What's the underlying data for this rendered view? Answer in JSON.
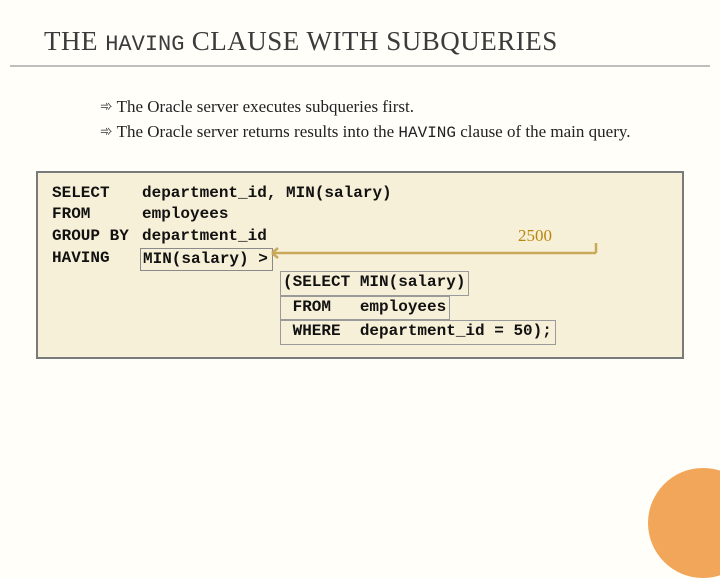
{
  "title": {
    "pre": "THE ",
    "mono": "HAVING",
    "post": " CLAUSE WITH SUBQUERIES"
  },
  "bullets": [
    {
      "pre": "The Oracle server executes subqueries first.",
      "mono": "",
      "post": ""
    },
    {
      "pre": "The Oracle server returns results into the ",
      "mono": "HAVING",
      "post": " clause of the main query."
    }
  ],
  "code": {
    "l1kw": "SELECT",
    "l1rest": "department_id, MIN(salary)",
    "l2kw": "FROM",
    "l2rest": "employees",
    "l3kw": "GROUP BY",
    "l3rest": "department_id",
    "l4kw": "HAVING",
    "l4expr": "MIN(salary) >",
    "s1": "(SELECT MIN(salary)",
    "s2": " FROM   employees",
    "s3": " WHERE  department_id = 50);"
  },
  "annotation_value": "2500"
}
